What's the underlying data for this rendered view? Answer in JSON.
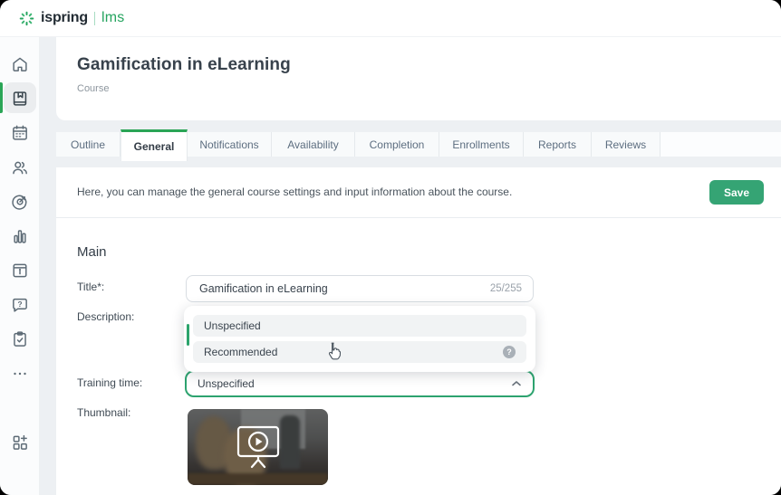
{
  "brand": {
    "name": "ispring",
    "product": "lms"
  },
  "colors": {
    "accent_green": "#2da36f",
    "save_button_green": "#35a474",
    "active_tab_green": "#2aa556",
    "logo_green": "#25a45f"
  },
  "sidebar": {
    "icons": [
      "home-icon",
      "book-icon",
      "calendar-icon",
      "users-icon",
      "target-icon",
      "bar-chart-icon",
      "info-panel-icon",
      "help-chat-icon",
      "tasks-icon",
      "more-icon",
      "apps-icon"
    ],
    "active_icon": "book-icon"
  },
  "header": {
    "title": "Gamification in eLearning",
    "subtitle": "Course"
  },
  "tabs": [
    {
      "label": "Outline"
    },
    {
      "label": "General",
      "active": true
    },
    {
      "label": "Notifications"
    },
    {
      "label": "Availability"
    },
    {
      "label": "Completion"
    },
    {
      "label": "Enrollments"
    },
    {
      "label": "Reports"
    },
    {
      "label": "Reviews"
    }
  ],
  "general": {
    "intro": "Here, you can manage the general course settings and input information about the course.",
    "save_label": "Save",
    "section": "Main",
    "title_field": {
      "label": "Title*:",
      "value": "Gamification in eLearning",
      "counter": "25/255"
    },
    "description_field": {
      "label": "Description:"
    },
    "training_field": {
      "label": "Training time:",
      "value": "Unspecified"
    },
    "thumbnail_field": {
      "label": "Thumbnail:"
    },
    "training_dropdown": {
      "options": [
        {
          "label": "Unspecified",
          "selected": true
        },
        {
          "label": "Recommended",
          "has_help": true
        }
      ]
    }
  }
}
